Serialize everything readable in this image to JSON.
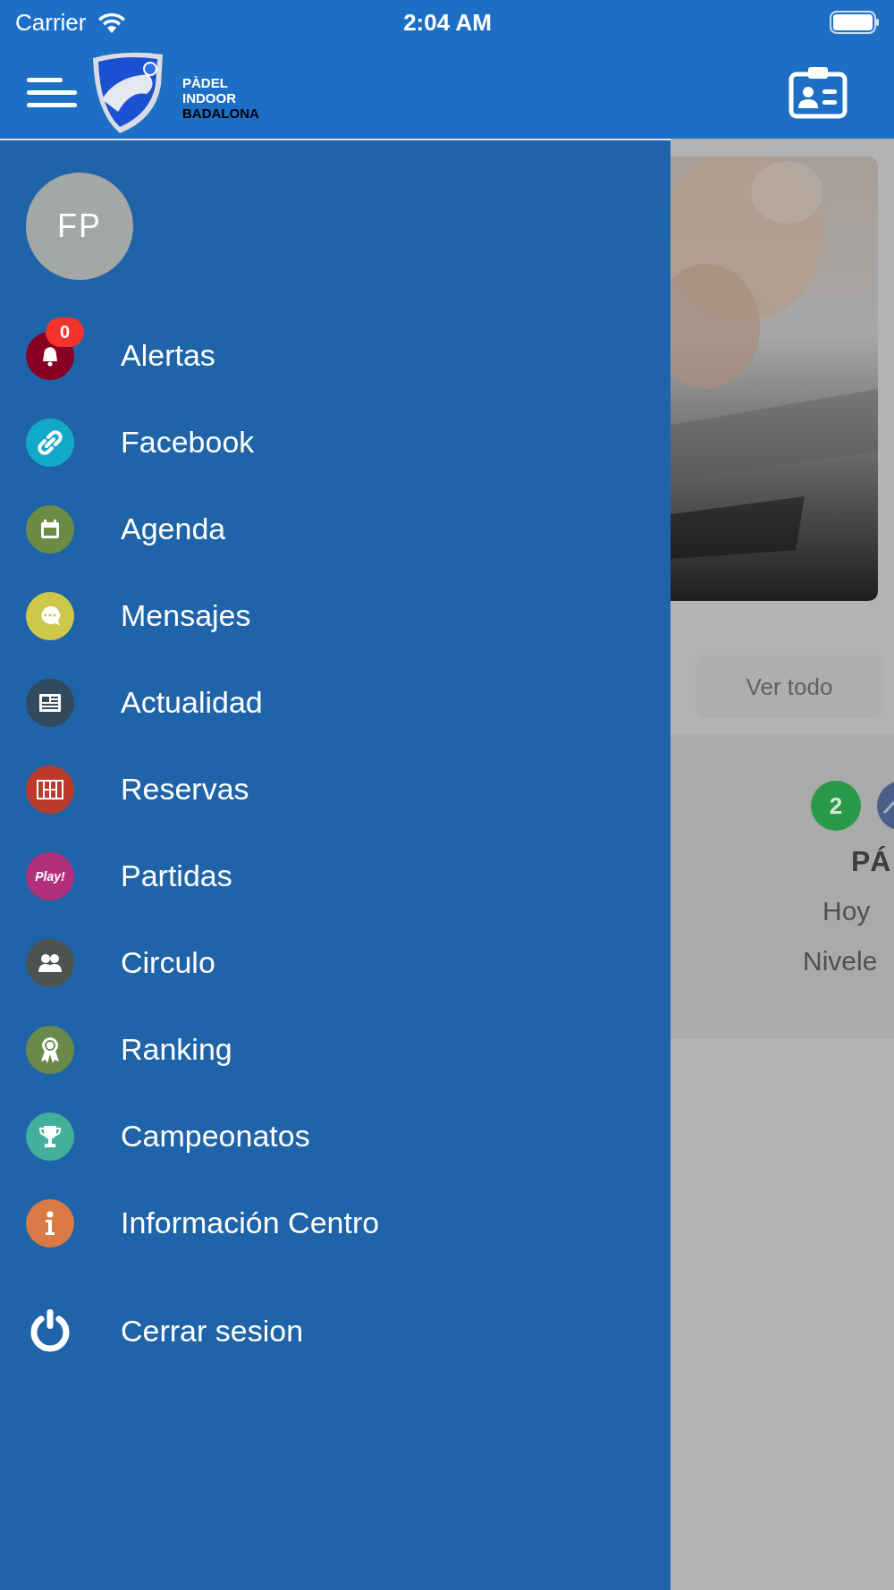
{
  "status_bar": {
    "carrier": "Carrier",
    "time": "2:04 AM"
  },
  "header": {
    "logo_lines": [
      "PÀDEL",
      "INDOOR",
      "BADALONA"
    ]
  },
  "drawer": {
    "avatar_initials": "FP",
    "items": [
      {
        "label": "Alertas",
        "kind": "bell",
        "color": "#8a0024",
        "badge": "0"
      },
      {
        "label": "Facebook",
        "kind": "link",
        "color": "#12a9c9"
      },
      {
        "label": "Agenda",
        "kind": "calendar",
        "color": "#6a8c45"
      },
      {
        "label": "Mensajes",
        "kind": "chat",
        "color": "#cdc84a"
      },
      {
        "label": "Actualidad",
        "kind": "news",
        "color": "#324a5e"
      },
      {
        "label": "Reservas",
        "kind": "court",
        "color": "#bd3b2a"
      },
      {
        "label": "Partidas",
        "kind": "text",
        "color": "#b22f7c",
        "icon_text": "Play!"
      },
      {
        "label": "Circulo",
        "kind": "people",
        "color": "#4d5450"
      },
      {
        "label": "Ranking",
        "kind": "ribbon",
        "color": "#698a48"
      },
      {
        "label": "Campeonatos",
        "kind": "trophy",
        "color": "#42b09c"
      },
      {
        "label": "Información Centro",
        "kind": "info",
        "color": "#d97a45"
      }
    ],
    "logout": "Cerrar sesion"
  },
  "background": {
    "view_all": "Ver todo",
    "count_badge": "2",
    "title": "PÁ",
    "line_1": "Hoy",
    "line_2": "Nivele"
  }
}
